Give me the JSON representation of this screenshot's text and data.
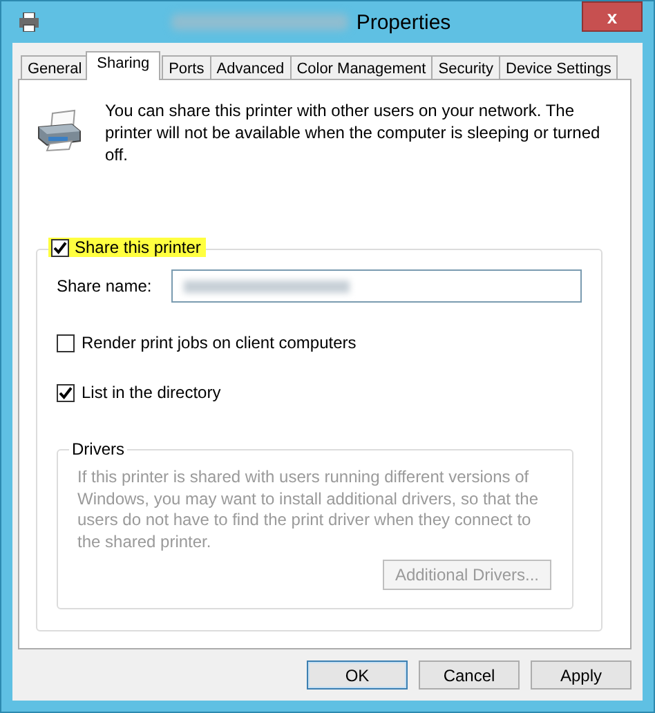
{
  "window": {
    "title": "Properties",
    "close": "x"
  },
  "tabs": [
    {
      "label": "General",
      "selected": false
    },
    {
      "label": "Sharing",
      "selected": true
    },
    {
      "label": "Ports",
      "selected": false
    },
    {
      "label": "Advanced",
      "selected": false
    },
    {
      "label": "Color Management",
      "selected": false
    },
    {
      "label": "Security",
      "selected": false
    },
    {
      "label": "Device Settings",
      "selected": false
    }
  ],
  "intro": "You can share this printer with other users on your network. The printer will not be available when the computer is sleeping or turned off.",
  "share": {
    "label": "Share this printer",
    "checked": true,
    "highlighted": true
  },
  "share_name": {
    "label": "Share name:"
  },
  "options": [
    {
      "label": "Render print jobs on client computers",
      "checked": false
    },
    {
      "label": "List in the directory",
      "checked": true
    }
  ],
  "drivers": {
    "title": "Drivers",
    "disabled": true,
    "text": "If this printer is shared with users running different versions of Windows, you may want to install additional drivers, so that the users do not have to find the print driver when they connect to the shared printer.",
    "button": "Additional Drivers..."
  },
  "buttons": [
    {
      "label": "OK",
      "default": true
    },
    {
      "label": "Cancel",
      "default": false
    },
    {
      "label": "Apply",
      "default": false
    }
  ]
}
